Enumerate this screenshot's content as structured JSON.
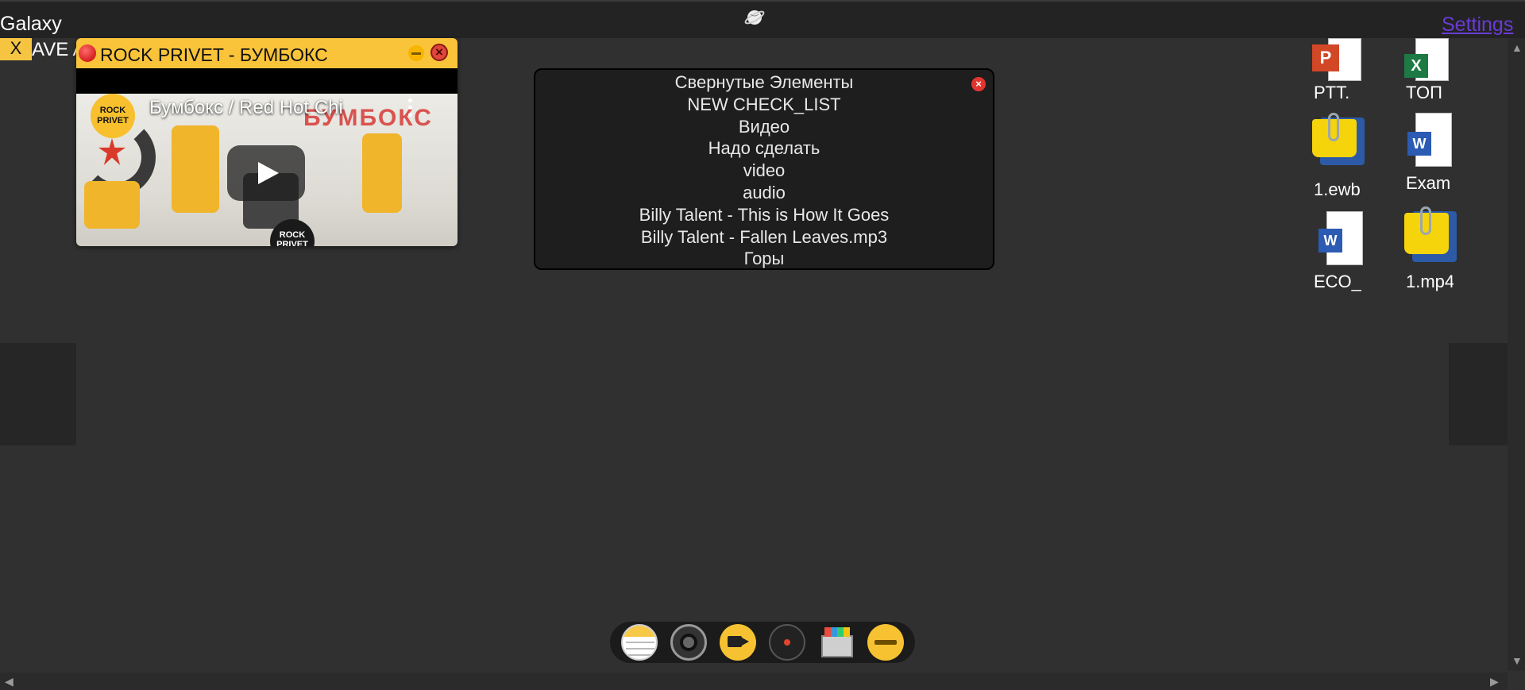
{
  "topbar": {
    "app_title": "Galaxy",
    "logo_icon": "planet-icon",
    "settings_label": "Settings"
  },
  "background_label": "AVE A",
  "x_tab_label": "X",
  "video_window": {
    "title": "ROCK PRIVET - БУМБОКС",
    "video_title": "Бумбокс / Red Hot Chi",
    "channel_logo_text": "ROCK PRIVET",
    "drum_logo_text": "ROCK PRIVET",
    "band_text": "БУМБОКС"
  },
  "collapsed_panel": {
    "heading": "Свернутые Элементы",
    "items": [
      "NEW CHECK_LIST",
      "Видео",
      "Надо сделать",
      "video",
      "audio",
      "Billy Talent - This is How It Goes",
      "Billy Talent - Fallen Leaves.mp3",
      "Горы"
    ]
  },
  "desktop_icons": [
    {
      "label": "PTT.",
      "type": "powerpoint-icon"
    },
    {
      "label": "TOП",
      "type": "excel-icon"
    },
    {
      "label": "1.ewb",
      "type": "clip-file-icon"
    },
    {
      "label": "Exam",
      "type": "word-icon"
    },
    {
      "label": "ECO_",
      "type": "word-icon"
    },
    {
      "label": "1.mp4",
      "type": "clip-file-icon"
    }
  ],
  "dock": {
    "buttons": [
      "notes-icon",
      "camera-icon",
      "video-camera-icon",
      "audio-disc-icon",
      "archive-icon",
      "minimize-icon"
    ]
  },
  "colors": {
    "accent": "#f9c33a",
    "background": "#303030",
    "link": "#6a3bd4",
    "close": "#e3342f"
  }
}
